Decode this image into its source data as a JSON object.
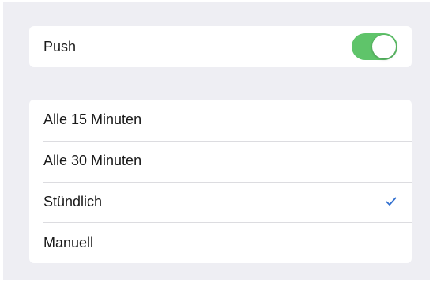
{
  "push": {
    "label": "Push",
    "enabled": true,
    "toggle_color": "#5fc46a"
  },
  "fetch_interval": {
    "options": [
      {
        "label": "Alle 15 Minuten",
        "selected": false
      },
      {
        "label": "Alle 30 Minuten",
        "selected": false
      },
      {
        "label": "Stündlich",
        "selected": true
      },
      {
        "label": "Manuell",
        "selected": false
      }
    ],
    "checkmark_icon": "checkmark-icon",
    "checkmark_color": "#2f6ecf"
  }
}
